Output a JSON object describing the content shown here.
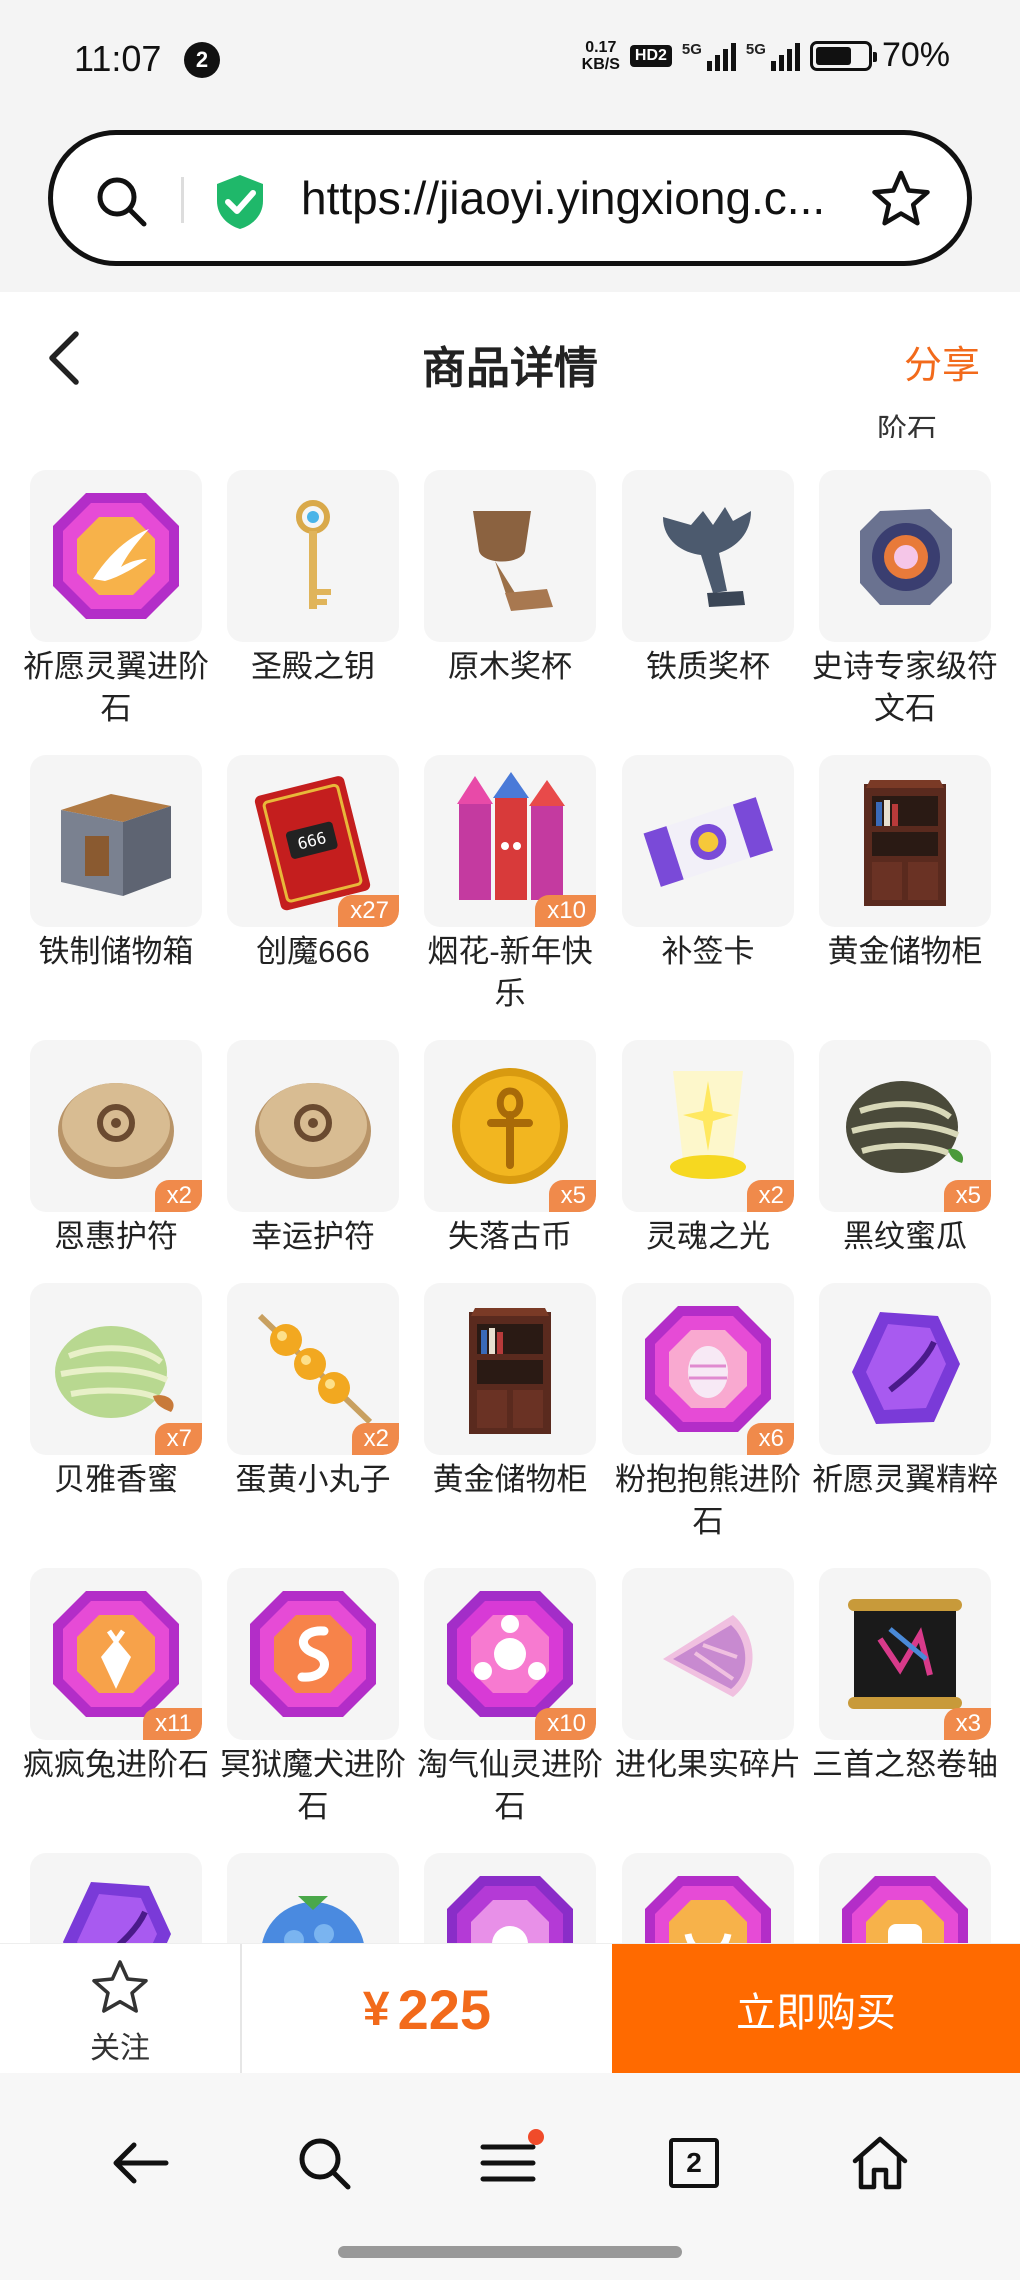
{
  "status_bar": {
    "time": "11:07",
    "notification_count": "2",
    "net_speed_top": "0.17",
    "net_speed_unit": "KB/S",
    "hd_label": "HD2",
    "signal1_label": "5G",
    "signal2_label": "5G",
    "battery_level": 0.7,
    "battery_text": "70%"
  },
  "url_bar": {
    "url": "https://jiaoyi.yingxiong.c..."
  },
  "header": {
    "title": "商品详情",
    "share": "分享",
    "partial_label": "阶石"
  },
  "items": [
    {
      "label": "祈愿灵翼进阶石",
      "count": "",
      "icon": "wing-gem-icon"
    },
    {
      "label": "圣殿之钥",
      "count": "",
      "icon": "key-icon"
    },
    {
      "label": "原木奖杯",
      "count": "",
      "icon": "wood-trophy-icon"
    },
    {
      "label": "铁质奖杯",
      "count": "",
      "icon": "iron-trophy-icon"
    },
    {
      "label": "史诗专家级符文石",
      "count": "",
      "icon": "rune-stone-icon"
    },
    {
      "label": "铁制储物箱",
      "count": "",
      "icon": "chest-icon"
    },
    {
      "label": "创魔666",
      "count": "x27",
      "icon": "card-icon"
    },
    {
      "label": "烟花-新年快乐",
      "count": "x10",
      "icon": "firework-icon"
    },
    {
      "label": "补签卡",
      "count": "",
      "icon": "ticket-icon"
    },
    {
      "label": "黄金储物柜",
      "count": "",
      "icon": "bookshelf-icon"
    },
    {
      "label": "恩惠护符",
      "count": "x2",
      "icon": "amulet-icon"
    },
    {
      "label": "幸运护符",
      "count": "",
      "icon": "amulet-icon"
    },
    {
      "label": "失落古币",
      "count": "x5",
      "icon": "coin-icon"
    },
    {
      "label": "灵魂之光",
      "count": "x2",
      "icon": "soul-light-icon"
    },
    {
      "label": "黑纹蜜瓜",
      "count": "x5",
      "icon": "dark-melon-icon"
    },
    {
      "label": "贝雅香蜜",
      "count": "x7",
      "icon": "melon-icon"
    },
    {
      "label": "蛋黄小丸子",
      "count": "x2",
      "icon": "skewer-icon"
    },
    {
      "label": "黄金储物柜",
      "count": "",
      "icon": "bookshelf-icon"
    },
    {
      "label": "粉抱抱熊进阶石",
      "count": "x6",
      "icon": "egg-gem-icon"
    },
    {
      "label": "祈愿灵翼精粹",
      "count": "",
      "icon": "purple-crystal-icon"
    },
    {
      "label": "疯疯兔进阶石",
      "count": "x11",
      "icon": "carrot-gem-icon"
    },
    {
      "label": "冥狱魔犬进阶石",
      "count": "",
      "icon": "serpent-gem-icon"
    },
    {
      "label": "淘气仙灵进阶石",
      "count": "x10",
      "icon": "fairy-gem-icon"
    },
    {
      "label": "进化果实碎片",
      "count": "",
      "icon": "fruit-shard-icon"
    },
    {
      "label": "三首之怒卷轴",
      "count": "x3",
      "icon": "scroll-icon"
    },
    {
      "label": "",
      "count": "",
      "icon": "purple-crystal-icon"
    },
    {
      "label": "",
      "count": "",
      "icon": "blue-berry-icon"
    },
    {
      "label": "",
      "count": "",
      "icon": "skull-gem-icon"
    },
    {
      "label": "",
      "count": "",
      "icon": "horn-gem-icon"
    },
    {
      "label": "",
      "count": "",
      "icon": "shield-gem-icon"
    }
  ],
  "action_bar": {
    "follow": "关注",
    "currency": "¥",
    "price": "225",
    "buy": "立即购买"
  },
  "browser_nav": {
    "tabs_count": "2"
  },
  "colors": {
    "accent": "#ff6a00",
    "share_text": "#f26a1b",
    "badge": "#f08a4b"
  }
}
